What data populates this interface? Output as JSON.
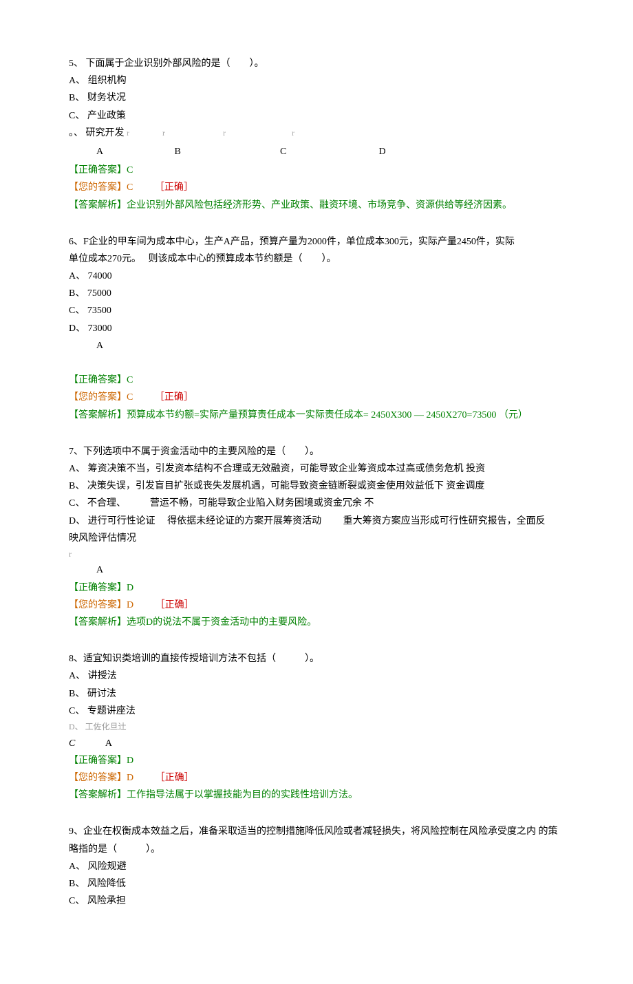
{
  "q5": {
    "stem": "5、 下面属于企业识别外部风险的是（　　）。",
    "optA": "A、 组织机构",
    "optB": "B、 财务状况",
    "optC": "C、 产业政策",
    "optD": "。、 研究开发",
    "radioLabels": [
      "A",
      "B",
      "C",
      "D"
    ],
    "correct": "【正确答案】C",
    "yours": "【您的答案】C",
    "status": "［正确］",
    "explain": "【答案解析】企业识别外部风险包括经济形势、产业政策、融资环境、市场竞争、资源供给等经济因素。"
  },
  "q6": {
    "stem1": "6、F企业的甲车间为成本中心，生产A产品，预算产量为2000件，单位成本300元，实际产量2450件，实际",
    "stem2": "单位成本270元。　 则该成本中心的预算成本节约额是（　　）。",
    "optA": "A、 74000",
    "optB": "B、 75000",
    "optC": "C、 73500",
    "optD": "D、 73000",
    "aletter": "A",
    "correct": "【正确答案】C",
    "yours": "【您的答案】C",
    "status": "［正确］",
    "explain": "【答案解析】预算成本节约额=实际产量预算责任成本一实际责任成本= 2450X300 — 2450X270=73500 （元）"
  },
  "q7": {
    "stem": "7、下列选项中不属于资金活动中的主要风险的是（　　）。",
    "optA": "A、 筹资决策不当，引发资本结构不合理或无效融资，可能导致企业筹资成本过高或债务危机  投资",
    "optB": "B、 决策失误，引发盲目扩张或丧失发展机遇，可能导致资金链断裂或资金使用效益低下  资金调度",
    "optC": "C、 不合理、　　　营运不畅，可能导致企业陷入财务困境或资金冗余  不",
    "optD": "D、 进行可行性论证　 得依据未经论证的方案开展筹资活动　　 重大筹资方案应当形成可行性研究报告，全面反",
    "optD2": "映风险评估情况",
    "aletter": "A",
    "correct": "【正确答案】D",
    "yours": "【您的答案】D",
    "status": "［正确］",
    "explain": "【答案解析】选项D的说法不属于资金活动中的主要风险。"
  },
  "q8": {
    "stem": "8、适宜知识类培训的直接传授培训方法不包括（　　　）。",
    "optA": "A、 讲授法",
    "optB": "B、 研讨法",
    "optC": "C、 专题讲座法",
    "optD": "D、  工佐化旦辻",
    "cletter": "C",
    "aletter": "A",
    "correct": "【正确答案】D",
    "yours": "【您的答案】D",
    "status": "［正确］",
    "explain": "【答案解析】工作指导法属于以掌握技能为目的的实践性培训方法。"
  },
  "q9": {
    "stem1": "9、企业在权衡成本效益之后，准备采取适当的控制措施降低风险或者减轻损失，将风险控制在风险承受度之内  的策",
    "stem2": "略指的是（　　　）。",
    "optA": "A、 风险规避",
    "optB": "B、 风险降低",
    "optC": "C、 风险承担"
  }
}
